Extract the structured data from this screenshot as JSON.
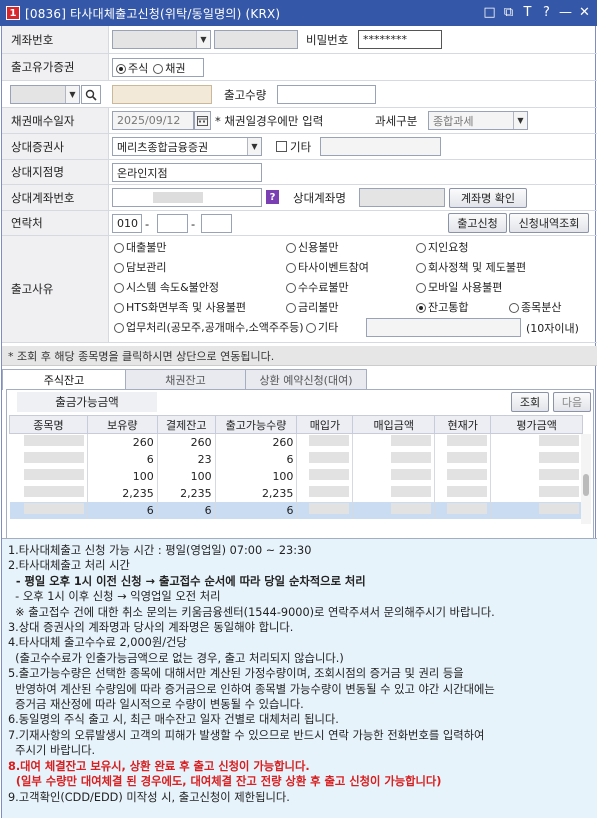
{
  "window": {
    "title": "[0836] 타사대체출고신청(위탁/동일명의) (KRX)",
    "badge": "1",
    "controls": [
      "□",
      "⧉",
      "T",
      "?",
      "—",
      "✕"
    ]
  },
  "form": {
    "account_label": "계좌번호",
    "password_label": "비밀번호",
    "password_value": "********",
    "security_type_label": "출고유가증권",
    "security_type_options": [
      "주식",
      "채권"
    ],
    "security_type_selected": "주식",
    "quantity_label": "출고수량",
    "bond_date_label": "채권매수일자",
    "bond_date_value": "2025/09/12",
    "bond_note": "* 채권일경우에만 입력",
    "tax_label": "과세구분",
    "tax_value": "종합과세",
    "counter_broker_label": "상대증권사",
    "counter_broker_value": "메리츠종합금융증권",
    "etc_label": "기타",
    "counter_branch_label": "상대지점명",
    "counter_branch_value": "온라인지점",
    "counter_account_label": "상대계좌번호",
    "counter_account_name_label": "상대계좌명",
    "check_name_button": "계좌명 확인",
    "contact_label": "연락처",
    "contact_prefix": "010",
    "contact_sep": "-",
    "apply_button": "출고신청",
    "history_button": "신청내역조회",
    "reason_label": "출고사유",
    "reasons": [
      {
        "label": "대출불만",
        "selected": false
      },
      {
        "label": "신용불만",
        "selected": false
      },
      {
        "label": "지인요청",
        "selected": false
      },
      {
        "label": "담보관리",
        "selected": false
      },
      {
        "label": "타사이벤트참여",
        "selected": false
      },
      {
        "label": "회사정책 및 제도불편",
        "selected": false
      },
      {
        "label": "시스템 속도&불안정",
        "selected": false
      },
      {
        "label": "수수료불만",
        "selected": false
      },
      {
        "label": "모바일 사용불편",
        "selected": false
      },
      {
        "label": "HTS화면부족 및 사용불편",
        "selected": false
      },
      {
        "label": "금리불만",
        "selected": false
      },
      {
        "label": "잔고통합",
        "selected": true
      },
      {
        "label": "종목분산",
        "selected": false
      },
      {
        "label": "업무처리(공모주,공개매수,소액주주등)",
        "selected": false
      },
      {
        "label": "기타",
        "selected": false
      }
    ],
    "reason_etc_hint": "(10자이내)"
  },
  "notice": "* 조회 후 해당 종목명을 클릭하시면 상단으로 연동됩니다.",
  "tabs": [
    "주식잔고",
    "채권잔고",
    "상환 예약신청(대여)"
  ],
  "active_tab": "주식잔고",
  "balance": {
    "avail_label": "출금가능금액",
    "query_button": "조회",
    "next_button": "다음",
    "columns": [
      "종목명",
      "보유량",
      "결제잔고",
      "출고가능수량",
      "매입가",
      "매입금액",
      "현재가",
      "평가금액"
    ],
    "rows": [
      [
        "260",
        "260",
        "260"
      ],
      [
        "6",
        "23",
        "6"
      ],
      [
        "100",
        "100",
        "100"
      ],
      [
        "2,235",
        "2,235",
        "2,235"
      ],
      [
        "6",
        "6",
        "6"
      ]
    ]
  },
  "notes": [
    {
      "text": "1.타사대체출고 신청 가능 시간 : 평일(영업일) 07:00 ~ 23:30",
      "style": "normal"
    },
    {
      "text": "2.타사대체출고 처리 시간",
      "style": "normal"
    },
    {
      "text": "  - 평일 오후 1시 이전 신청 → 출고접수 순서에 따라 당일 순차적으로 처리",
      "style": "bold"
    },
    {
      "text": "  - 오후 1시 이후 신청 → 익영업일 오전 처리",
      "style": "normal"
    },
    {
      "text": "  ※ 출고접수 건에 대한 취소 문의는 키움금융센터(1544-9000)로 연락주셔서 문의해주시기 바랍니다.",
      "style": "normal"
    },
    {
      "text": "3.상대 증권사의 계좌명과 당사의 계좌명은 동일해야 합니다.",
      "style": "normal"
    },
    {
      "text": "4.타사대체 출고수수료 2,000원/건당",
      "style": "normal"
    },
    {
      "text": "  (출고수수료가 인출가능금액으로 없는 경우, 출고 처리되지 않습니다.)",
      "style": "normal"
    },
    {
      "text": "5.출고가능수량은 선택한 종목에 대해서만 계산된 가정수량이며, 조회시점의 증거금 및 권리 등을",
      "style": "normal"
    },
    {
      "text": "  반영하여 계산된 수량임에 따라 증거금으로 인하여 종목별 가능수량이 변동될 수 있고 야간 시간대에는",
      "style": "normal"
    },
    {
      "text": "  증거금 재산정에 따라 일시적으로 수량이 변동될 수 있습니다.",
      "style": "normal"
    },
    {
      "text": "6.동일명의 주식 출고 시, 최근 매수잔고 일자 건별로 대체처리 됩니다.",
      "style": "normal"
    },
    {
      "text": "7.기재사항의 오류발생시 고객의 피해가 발생할 수 있으므로 반드시 연락 가능한 전화번호를 입력하여",
      "style": "normal"
    },
    {
      "text": "  주시기 바랍니다.",
      "style": "normal"
    },
    {
      "text": "8.대여 체결잔고 보유시, 상환 완료 후 출고 신청이 가능합니다.",
      "style": "red"
    },
    {
      "text": "  (일부 수량만 대여체결 된 경우에도, 대여체결 잔고 전량 상환 후 출고 신청이 가능합니다)",
      "style": "red"
    },
    {
      "text": "9.고객확인(CDD/EDD) 미작성 시, 출고신청이 제한됩니다.",
      "style": "normal"
    }
  ]
}
